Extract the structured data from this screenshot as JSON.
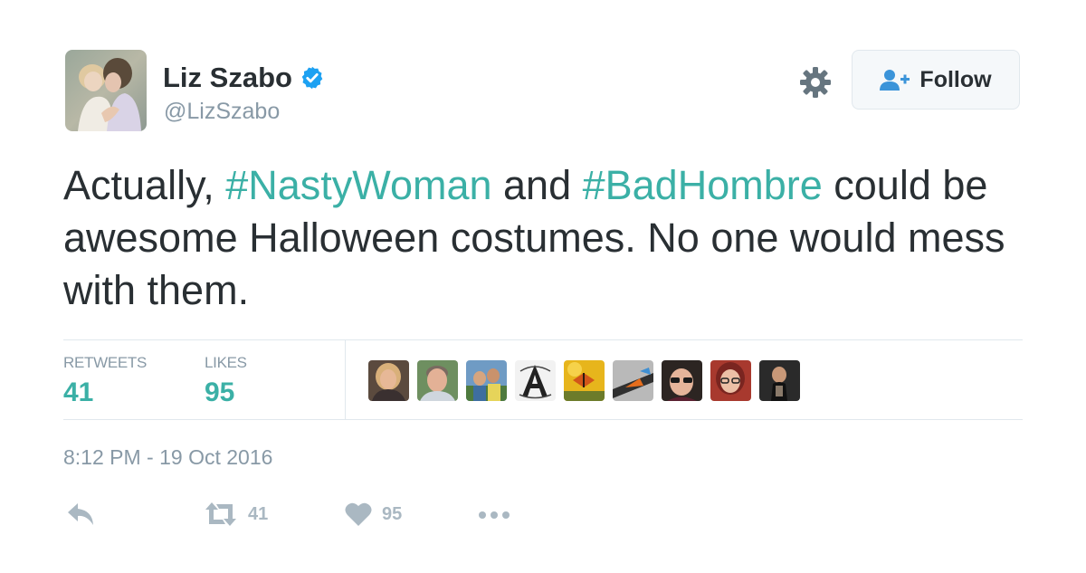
{
  "user": {
    "display_name": "Liz Szabo",
    "handle": "@LizSzabo",
    "verified_icon": "verified-badge-icon",
    "avatar_icon": "profile-avatar"
  },
  "header": {
    "settings_icon": "gear-icon",
    "follow_label": "Follow",
    "follow_icon": "follow-user-icon"
  },
  "tweet": {
    "text_before": "Actually, ",
    "hashtag1": "#NastyWoman",
    "text_middle": " and ",
    "hashtag2": "#BadHombre",
    "text_after": " could be awesome Halloween costumes. No one would mess with them.",
    "timestamp": "8:12 PM - 19 Oct 2016"
  },
  "stats": {
    "retweets_label": "RETWEETS",
    "retweets_value": "41",
    "likes_label": "LIKES",
    "likes_value": "95",
    "liker_avatar_count": 9
  },
  "actions": {
    "reply_icon": "reply-icon",
    "retweet_icon": "retweet-icon",
    "retweet_count": "41",
    "like_icon": "heart-icon",
    "like_count": "95",
    "more_icon": "more-icon"
  },
  "colors": {
    "accent": "#3bb0a6",
    "text": "#292f33",
    "muted": "#8899a6",
    "verified": "#1da1f2",
    "action_gray": "#aab8c2"
  }
}
